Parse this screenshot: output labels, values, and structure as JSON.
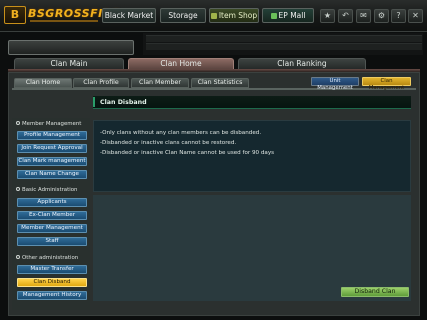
{
  "header": {
    "logo_text": "BSGROSSFIRE",
    "nav": {
      "black_market": "Black Market",
      "storage": "Storage",
      "item_shop": "Item Shop",
      "ep_mall": "EP Mall"
    },
    "system_buttons": [
      {
        "icon": "star-icon",
        "glyph": "★"
      },
      {
        "icon": "back-arrow-icon",
        "glyph": "↶"
      },
      {
        "icon": "mail-icon",
        "glyph": "✉"
      },
      {
        "icon": "gear-icon",
        "glyph": "⚙"
      },
      {
        "icon": "help-icon",
        "glyph": "?"
      },
      {
        "icon": "close-icon",
        "glyph": "✕"
      }
    ]
  },
  "main_tabs": [
    "Clan Main",
    "Clan Home",
    "Clan Ranking"
  ],
  "sub_tabs": [
    "Clan Home",
    "Clan Profile",
    "Clan Member",
    "Clan Statistics"
  ],
  "management_buttons": {
    "unit": "Unit Management",
    "clan": "Clan Management"
  },
  "sidebar": {
    "sections": [
      {
        "title": "Member Management",
        "items": [
          "Profile Management",
          "Join Request Approval",
          "Clan Mark management",
          "Clan Name Change"
        ]
      },
      {
        "title": "Basic Administration",
        "items": [
          "Applicants",
          "Ex-Clan Member",
          "Member Management",
          "Staff"
        ]
      },
      {
        "title": "Other administration",
        "items": [
          "Master Transfer",
          "Clan Disband",
          "Management History"
        ]
      }
    ]
  },
  "content": {
    "title": "Clan Disband",
    "notices": [
      "-Only clans without any clan members can be disbanded.",
      "-Disbanded or inactive clans cannot be restored.",
      "-Disbanded or inactive Clan Name cannot be used for 90 days"
    ],
    "disband_button": "Disband Clan"
  },
  "colors": {
    "accent_gold": "#f2b21e",
    "active_tab": "#8c6a63",
    "sidebar_button": "#2f6c98",
    "active_sidebar_button": "#e0a812",
    "disband_button": "#7fb852"
  }
}
